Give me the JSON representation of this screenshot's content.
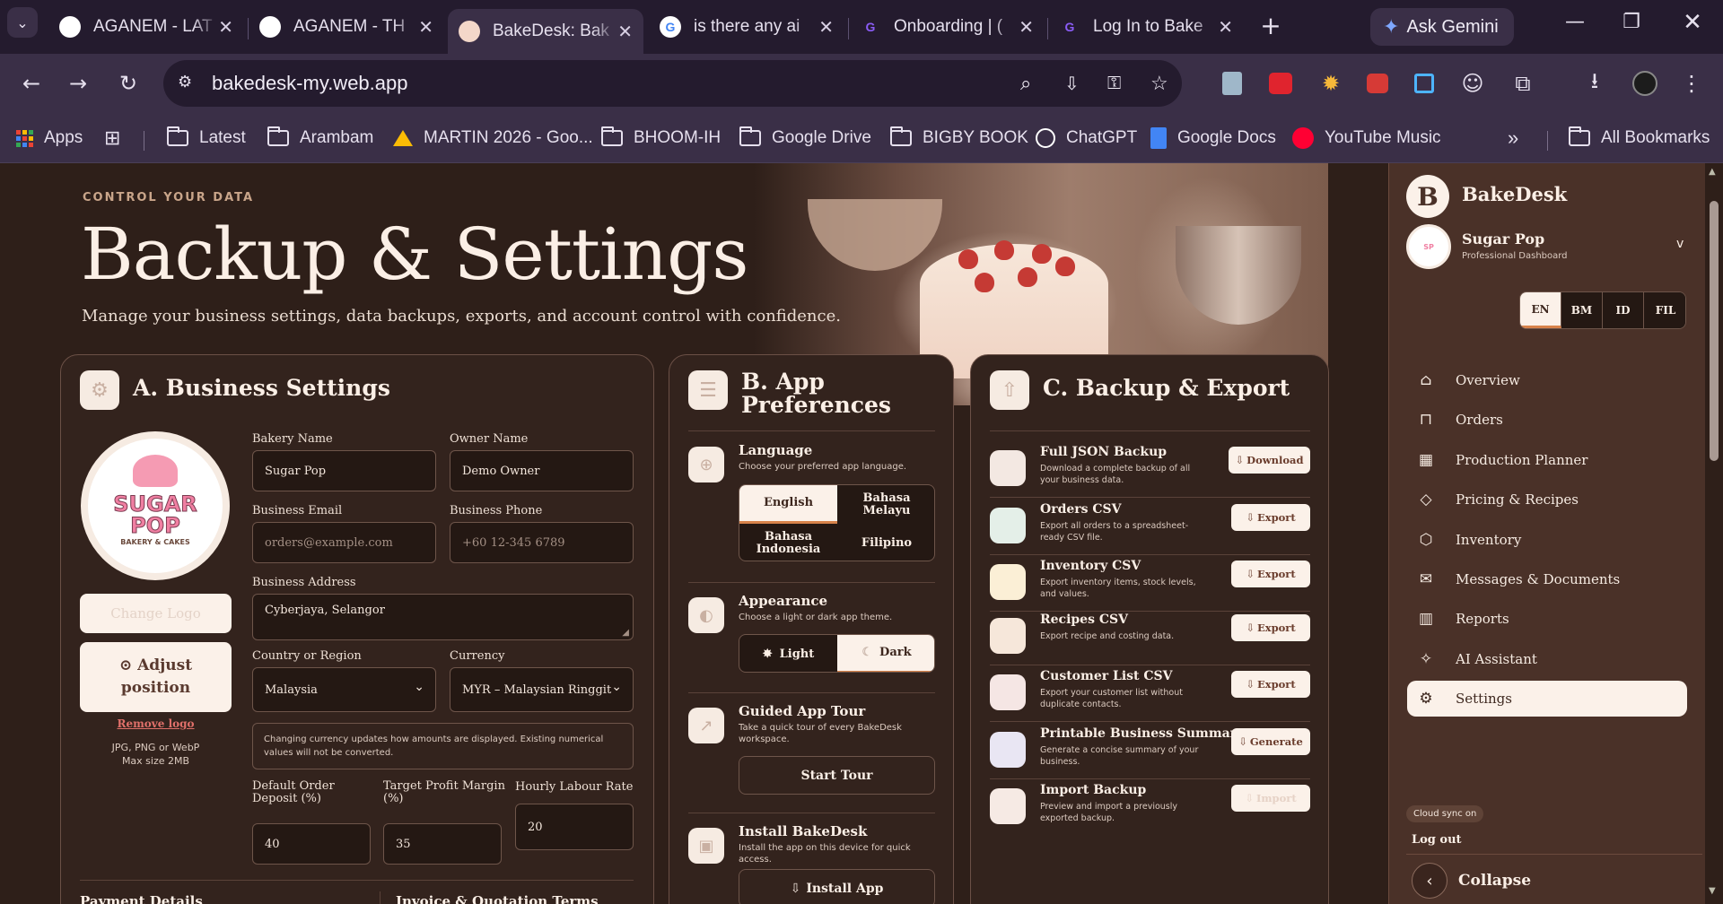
{
  "browser": {
    "tabs": [
      {
        "title": "AGANEM - LAT",
        "icon": "chatgpt-icon"
      },
      {
        "title": "AGANEM - TH",
        "icon": "chatgpt-icon"
      },
      {
        "title": "BakeDesk: Bak",
        "icon": "bakedesk-icon",
        "active": true
      },
      {
        "title": "is there any ai",
        "icon": "google-icon"
      },
      {
        "title": "Onboarding | (",
        "icon": "canva-icon"
      },
      {
        "title": "Log In to Bake",
        "icon": "canva-icon"
      }
    ],
    "gemini_label": "Ask Gemini",
    "url": "bakedesk-my.web.app",
    "bookmarks": [
      "Apps",
      "Latest",
      "Arambam",
      "MARTIN 2026 - Goo...",
      "BHOOM-IH",
      "Google Drive",
      "BIGBY BOOK",
      "ChatGPT",
      "Google Docs",
      "YouTube Music",
      "All Bookmarks"
    ],
    "more_bookmarks": "»"
  },
  "header": {
    "eyebrow": "CONTROL YOUR DATA",
    "title": "Backup & Settings",
    "subtitle": "Manage your business settings, data backups, exports, and account control with confidence."
  },
  "business": {
    "heading": "A. Business Settings",
    "logo_text": "SUGAR POP",
    "logo_sub": "BAKERY & CAKES",
    "change_logo": "Change Logo",
    "adjust_position": "Adjust position",
    "remove_logo": "Remove logo",
    "logo_hint1": "JPG, PNG or WebP",
    "logo_hint2": "Max size 2MB",
    "bakery_name_label": "Bakery Name",
    "bakery_name": "Sugar Pop",
    "owner_name_label": "Owner Name",
    "owner_name": "Demo Owner",
    "email_label": "Business Email",
    "email_placeholder": "orders@example.com",
    "phone_label": "Business Phone",
    "phone_placeholder": "+60 12-345 6789",
    "address_label": "Business Address",
    "address": "Cyberjaya, Selangor",
    "country_label": "Country or Region",
    "country": "Malaysia",
    "currency_label": "Currency",
    "currency": "MYR – Malaysian Ringgit",
    "currency_note": "Changing currency updates how amounts are displayed. Existing numerical values will not be converted.",
    "deposit_label": "Default Order Deposit (%)",
    "deposit": "40",
    "margin_label": "Target Profit Margin (%)",
    "margin": "35",
    "labour_label": "Hourly Labour Rate",
    "labour": "20",
    "payment_details": "Payment Details",
    "invoice_terms": "Invoice & Quotation Terms"
  },
  "prefs": {
    "heading1": "B. App",
    "heading2": "Preferences",
    "language_title": "Language",
    "language_desc": "Choose your preferred app language.",
    "languages": [
      "English",
      "Bahasa Melayu",
      "Bahasa Indonesia",
      "Filipino"
    ],
    "appearance_title": "Appearance",
    "appearance_desc": "Choose a light or dark app theme.",
    "light": "Light",
    "dark": "Dark",
    "tour_title": "Guided App Tour",
    "tour_desc": "Take a quick tour of every BakeDesk workspace.",
    "start_tour": "Start Tour",
    "install_title": "Install BakeDesk",
    "install_desc": "Install the app on this device for quick access.",
    "install_btn": "Install App"
  },
  "backup": {
    "heading": "C. Backup & Export",
    "items": [
      {
        "title": "Full JSON Backup",
        "desc": "Download a complete backup of all your business data.",
        "button": "Download",
        "color": "#f3e8e2"
      },
      {
        "title": "Orders CSV",
        "desc": "Export all orders to a spreadsheet-ready CSV file.",
        "button": "Export",
        "color": "#e4efe8"
      },
      {
        "title": "Inventory CSV",
        "desc": "Export inventory items, stock levels, and values.",
        "button": "Export",
        "color": "#fbefd6"
      },
      {
        "title": "Recipes CSV",
        "desc": "Export recipe and costing data.",
        "button": "Export",
        "color": "#f6e7da"
      },
      {
        "title": "Customer List CSV",
        "desc": "Export your customer list without duplicate contacts.",
        "button": "Export",
        "color": "#f5e6e4"
      },
      {
        "title": "Printable Business Summary",
        "desc": "Generate a concise summary of your business.",
        "button": "Generate",
        "color": "#e9e6f3"
      },
      {
        "title": "Import Backup",
        "desc": "Preview and import a previously exported backup.",
        "button": "Import",
        "color": "#f6eae4"
      }
    ]
  },
  "sidebar": {
    "brand": "BakeDesk",
    "brand_letter": "B",
    "business_name": "Sugar Pop",
    "business_sub": "Professional Dashboard",
    "langs": [
      "EN",
      "BM",
      "ID",
      "FIL"
    ],
    "nav": [
      {
        "label": "Overview",
        "icon": "home-icon"
      },
      {
        "label": "Orders",
        "icon": "bag-icon"
      },
      {
        "label": "Production Planner",
        "icon": "calendar-icon"
      },
      {
        "label": "Pricing & Recipes",
        "icon": "tag-icon"
      },
      {
        "label": "Inventory",
        "icon": "box-icon"
      },
      {
        "label": "Messages & Documents",
        "icon": "mail-icon"
      },
      {
        "label": "Reports",
        "icon": "chart-icon"
      },
      {
        "label": "AI Assistant",
        "icon": "sparkle-icon"
      },
      {
        "label": "Settings",
        "icon": "gear-icon",
        "active": true
      }
    ],
    "cloud": "Cloud sync on",
    "logout": "Log out",
    "collapse": "Collapse"
  },
  "colors": {
    "accent": "#d7824a",
    "sidebar": "#4a3128",
    "page": "#2e1f19"
  }
}
